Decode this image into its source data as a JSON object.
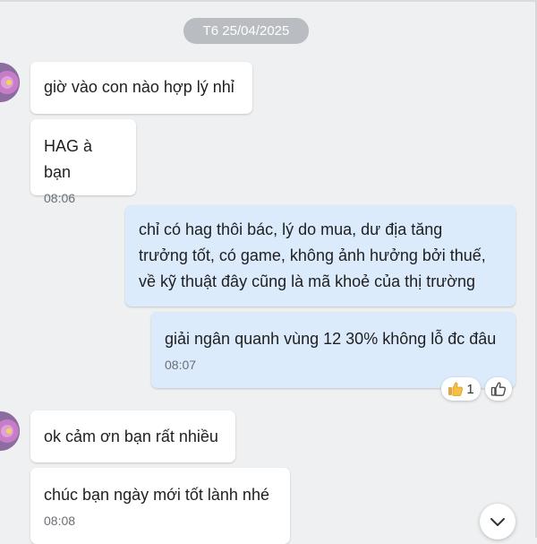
{
  "date_divider": "T6 25/04/2025",
  "messages": [
    {
      "text": "giờ vào con nào hợp lý nhỉ",
      "time": ""
    },
    {
      "text": "HAG à bạn",
      "time": "08:06"
    },
    {
      "text": "chỉ có hag thôi bác, lý do mua, dư địa tăng\ntrưởng tốt, có game, không ảnh hưởng bởi thuế,\nvề kỹ thuật đây cũng là mã khoẻ của thị trường",
      "time": ""
    },
    {
      "text": "giải ngân quanh vùng 12 30% không lỗ đc đâu",
      "time": "08:07"
    },
    {
      "text": "ok cảm ơn bạn rất nhiều",
      "time": ""
    },
    {
      "text": "chúc bạn ngày mới tốt lành nhé",
      "time": "08:08"
    }
  ],
  "reaction": {
    "icon": "thumbs-up-emoji",
    "count": "1"
  },
  "icons": {
    "add_reaction": "like-outline-icon",
    "scroll": "chevron-down-icon"
  },
  "colors": {
    "background": "#eef0f1",
    "outgoing_bubble": "#dbebfc",
    "incoming_bubble": "#ffffff",
    "date_pill": "#b9bdc1"
  }
}
